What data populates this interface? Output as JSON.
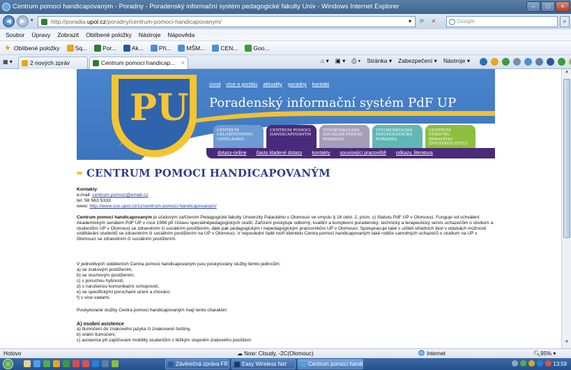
{
  "window": {
    "title": "Centrum pomoci handicapovaným - Poradny - Poradenský informační systém pedagogické fakulty Univ - Windows Internet Explorer"
  },
  "addressbar": {
    "url_prefix": "http://poradia.",
    "url_domain": "upol.cz",
    "url_path": "/poradny/centrum-pomoci-handicapovanym/",
    "search_placeholder": "Google"
  },
  "menubar": {
    "items": [
      "Soubor",
      "Úpravy",
      "Zobrazit",
      "Oblíbené položky",
      "Nástroje",
      "Nápověda"
    ]
  },
  "favbar": {
    "label": "Oblíbené položky",
    "items": [
      "Sq...",
      "Por...",
      "Ak...",
      "Při...",
      "MŠM...",
      "CEN...",
      "Goo..."
    ]
  },
  "tabs": {
    "group_label": "2 nových zpráv",
    "active_label": "Centrum pomoci handicap...",
    "commands": [
      "Stránka ▾",
      "Zabezpečení ▾",
      "Nástroje ▾"
    ]
  },
  "site": {
    "top_links": [
      "úvod",
      "více o portálu",
      "aktuality",
      "poradny",
      "kontakt"
    ],
    "title": "Poradenský informační systém PdF UP",
    "monogram": "PU",
    "section_tabs": [
      "CENTRUM CELOŽIVOTNÍHO VZDĚLÁVÁNÍ",
      "CENTRUM POMOCI HANDICAPOVANÝM",
      "VYSOKOŠKOLSKÁ SOCIÁLNĚ-PRÁVNÍ PORADNA",
      "VYSOKOŠKOLSKÁ PSYCHOLOGICKÁ PORADNA",
      "CENTRUM VÝZKUMU ZDRAVÉHO ŽIVOTNÍHO STYLU"
    ],
    "sub_nav": [
      "dotazy-online",
      "často kladené dotazy",
      "kontakty",
      "související pracoviště",
      "odkazy, literatura"
    ]
  },
  "content": {
    "heading": "CENTRUM POMOCI HANDICAPOVANÝM",
    "contacts_label": "Kontakty",
    "email_label": "e-mail:",
    "email": "centrum.pomoci@email.cz",
    "tel": "tel: 58 563 5333",
    "www_label": "www:",
    "www": "http://www.uss.upol.cz/cz/centrum-pomoci-handicapovanym/",
    "intro_bold": "Centrum pomoci handicapovaným",
    "intro_rest": " je účelovým zařízením Pedagogické fakulty Univerzity Palackého v Olomouci ve smyslu § 16 odst. 2, písm. c) Statutu PdF UP v Olomouci. Funguje od schválení Akademickým senátem PdF UP v roce 1996 při Ústavu speciálněpedagogických studií. Zařízení poskytuje odborný, kvalitní a komplexní poradenský, technický a terapeutický servis uchazečům o studium a studentům UP v Olomouci se zdravotním či sociálním postižením, dále pak pedagogickým i nepedagogickým pracovníkům UP v Olomouci. Spolupracuje také s učiteli středních škol v otázkách možností vzdělávání studentů se zdravotním či sociálním postižením na UP v Olomouci. V neposlední řadě tvoří klientelu Centra pomoci handicapovaným také rodiče samotných uchazečů o studium na UP v Olomouci se zdravotním či sociálním postižením.",
    "list_intro": "V jednotlivých odděleních Centra pomoci handicapovaným jsou poskytovány služby těmto jedincům:",
    "list": [
      "a) se zrakovým postižením,",
      "b) se sluchovým postižením,",
      "c) s poruchou hybnosti,",
      "d) s narušenou komunikační schopností,",
      "e) se specifickými poruchami učení a chování,",
      "f) s více vadami."
    ],
    "character": "Poskytované služby Centra pomoci handicapovaným mají tento charakter:",
    "sub_heading": "A) osobní asistence",
    "sub_list": [
      "a) tlumočení do znakového jazyka či znakované češtiny,",
      "b) orální tlumočení,",
      "c) asistence při zajišťování mobility studentům s těžkým stupněm zrakového postižení"
    ]
  },
  "statusbar": {
    "left": "Hotovo",
    "weather": "Now: Cloudy, -2C(Olomouc)",
    "zone": "Internet",
    "zoom": "95%"
  },
  "taskbar": {
    "tasks": [
      "Závěrečná zpráva FR...",
      "Easy Wireless Net",
      "Centrum pomoci handi..."
    ],
    "clock": "13:59"
  }
}
